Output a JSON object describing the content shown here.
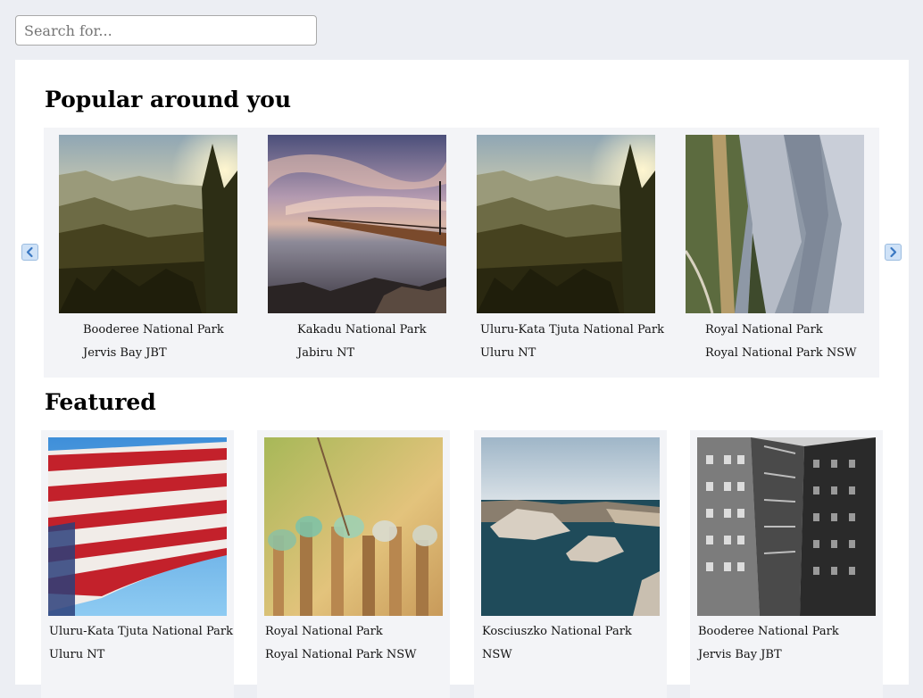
{
  "search": {
    "placeholder": "Search for..."
  },
  "popular": {
    "title": "Popular around you",
    "items": [
      {
        "name": "Booderee National Park",
        "location": "Jervis Bay JBT",
        "image": "sunset-hills-photo"
      },
      {
        "name": "Kakadu National Park",
        "location": "Jabiru NT",
        "image": "pier-sunset-photo"
      },
      {
        "name": "Uluru-Kata Tjuta National Park",
        "location": "Uluru NT",
        "image": "sunset-hills-photo"
      },
      {
        "name": "Royal National Park",
        "location": "Royal National Park NSW",
        "image": "mountain-valley-photo"
      }
    ]
  },
  "featured": {
    "title": "Featured",
    "items": [
      {
        "name": "Uluru-Kata Tjuta National Park",
        "location": "Uluru NT",
        "image": "flag-photo"
      },
      {
        "name": "Royal National Park",
        "location": "Royal National Park NSW",
        "image": "glass-bottles-photo"
      },
      {
        "name": "Kosciuszko National Park",
        "location": "NSW",
        "image": "coastal-rocks-photo"
      },
      {
        "name": "Booderee National Park",
        "location": "Jervis Bay JBT",
        "image": "old-building-photo"
      }
    ]
  },
  "icons": {
    "prev": "chevron-left-icon",
    "next": "chevron-right-icon"
  }
}
